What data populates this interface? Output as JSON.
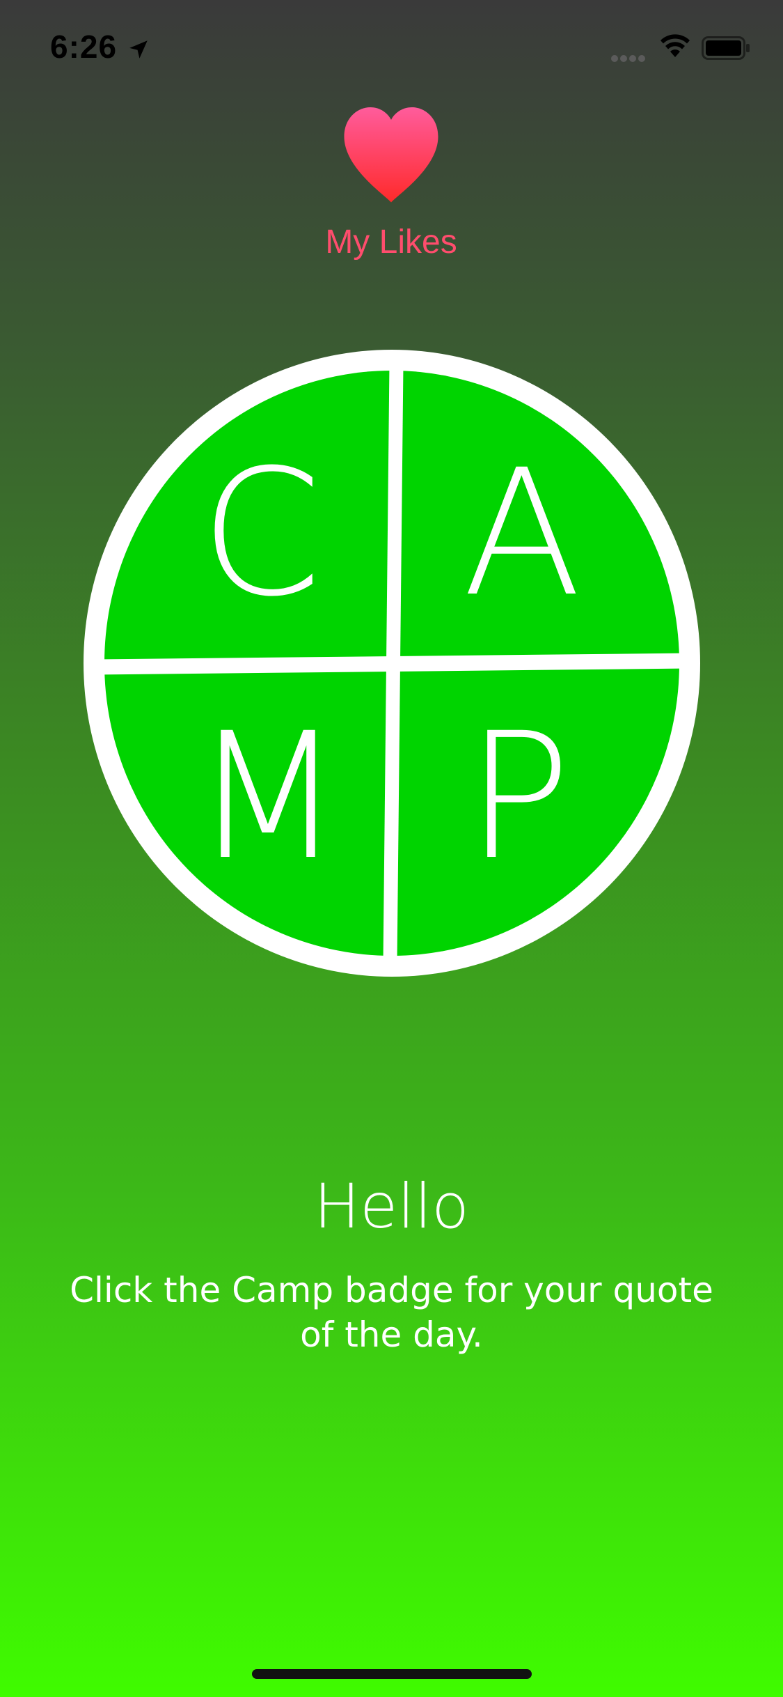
{
  "status_bar": {
    "time": "6:26",
    "location_icon": "location-arrow-icon",
    "wifi_icon": "wifi-icon",
    "battery_icon": "battery-icon"
  },
  "likes": {
    "label": "My Likes",
    "icon": "heart-icon",
    "color": "#ff4d6d"
  },
  "badge": {
    "letters": [
      "C",
      "A",
      "M",
      "P"
    ],
    "fill_color": "#00d400",
    "border_color": "#ffffff"
  },
  "greeting": {
    "title": "Hello",
    "message": "Click the Camp badge for your quote of the day."
  }
}
